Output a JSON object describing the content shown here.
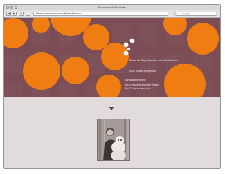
{
  "window": {
    "title": "Boermann Feldenkrais"
  },
  "toolbar": {
    "back_symbol": "◀",
    "forward_symbol": "▶",
    "reload_symbol": "⟳",
    "home_symbol": "+",
    "url": "https://www.boermann-feldenkrais.ch",
    "search_placeholder": "Google",
    "search_icon": "magnifier-icon"
  },
  "hero": {
    "colors": {
      "background": "#7d4d55",
      "circles": "#ef7d12",
      "logo_dots": "#ffffff"
    },
    "tagline_lines": [
      "Praxis für Physiotherapie und Rehabilitation",
      "nach Moshe Feldenkrais"
    ],
    "person": {
      "name": "Barbara Boermann",
      "role_lines": [
        "dipl. Physiotherapeutin FH Bsc",
        "dipl. Feldenkraislehrerin"
      ]
    }
  },
  "lower": {
    "background": "#e2dbdc",
    "scroll_indicator": "down-arrow-icon",
    "photo": "portrait-photo"
  }
}
